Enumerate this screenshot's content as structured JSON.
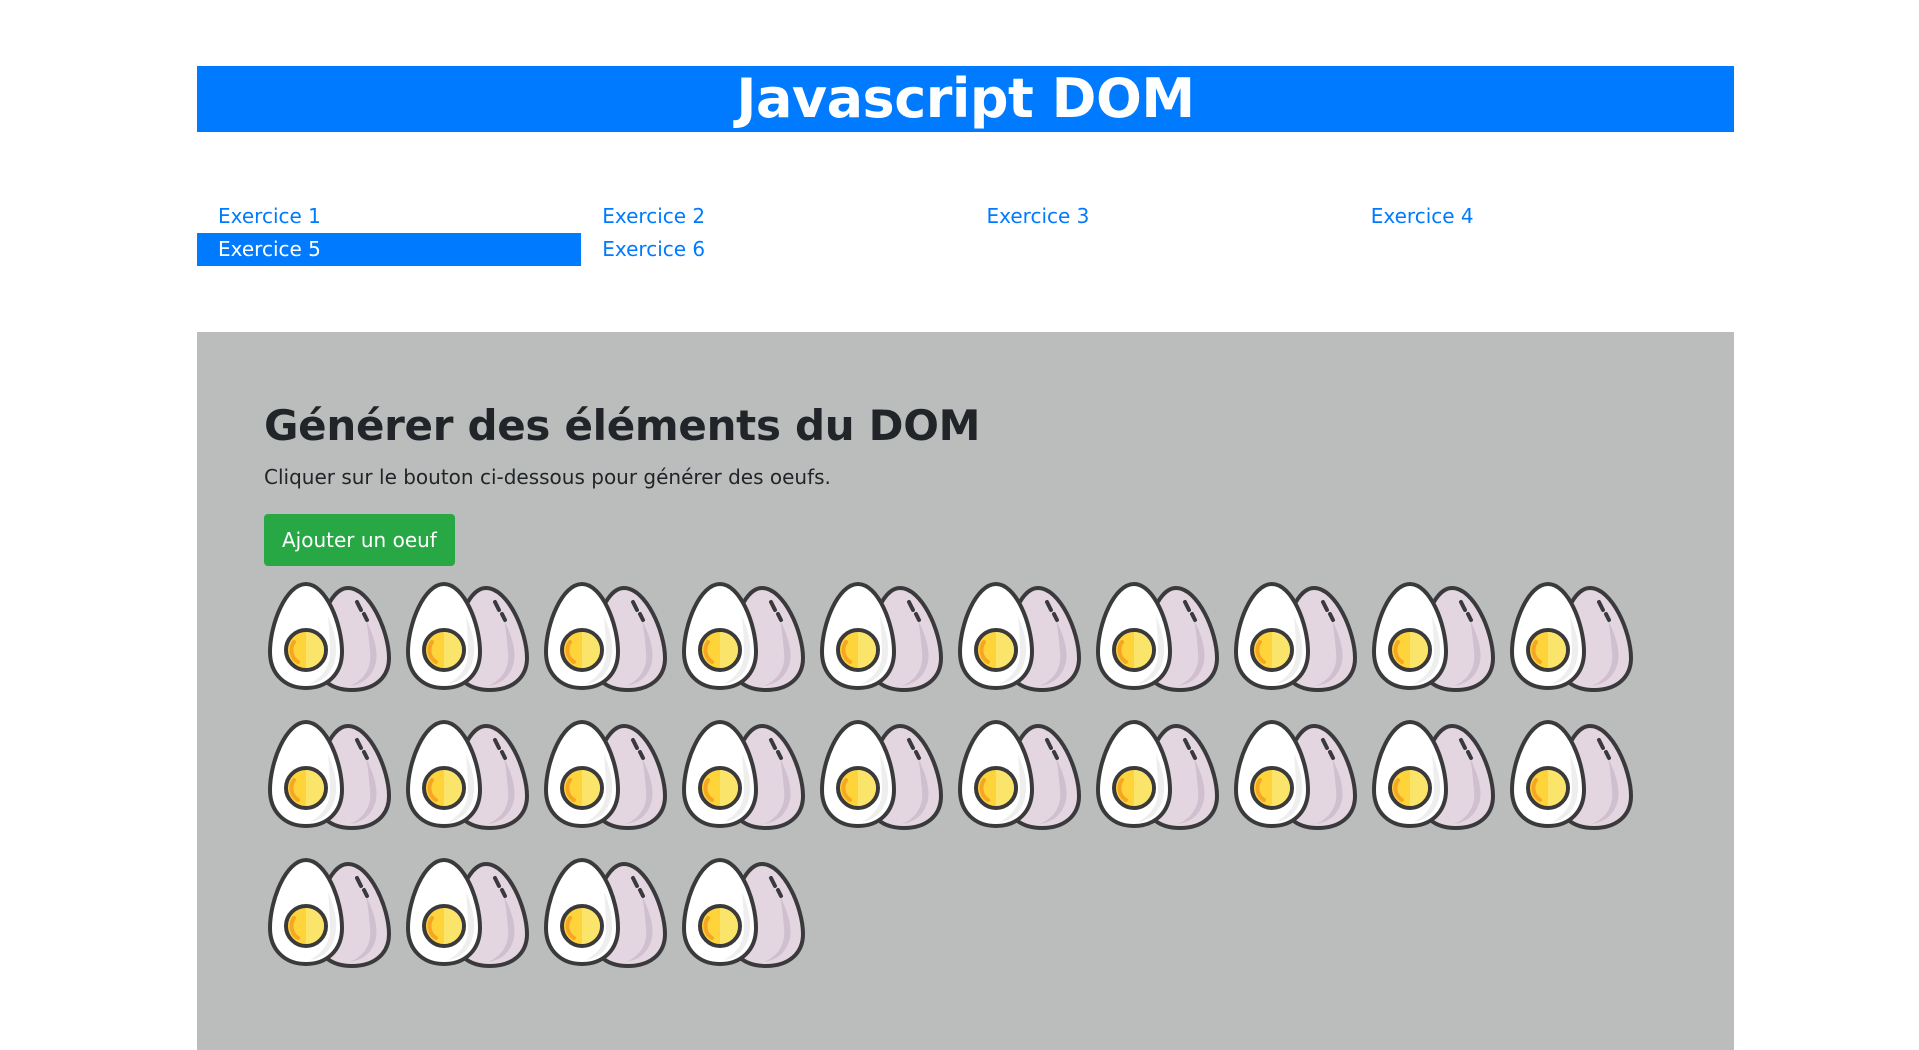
{
  "header": {
    "title": "Javascript DOM"
  },
  "nav": {
    "items": [
      {
        "label": "Exercice 1",
        "active": false
      },
      {
        "label": "Exercice 2",
        "active": false
      },
      {
        "label": "Exercice 3",
        "active": false
      },
      {
        "label": "Exercice 4",
        "active": false
      },
      {
        "label": "Exercice 5",
        "active": true
      },
      {
        "label": "Exercice 6",
        "active": false
      }
    ]
  },
  "main": {
    "title": "Générer des éléments du DOM",
    "description": "Cliquer sur le bouton ci-dessous pour générer des oeufs.",
    "add_button_label": "Ajouter un oeuf",
    "egg_icon": "boiled-egg-icon",
    "egg_count": 24
  },
  "colors": {
    "primary": "#007bff",
    "success": "#28a745",
    "panel_bg": "#bbbdbc",
    "text": "#212529"
  }
}
